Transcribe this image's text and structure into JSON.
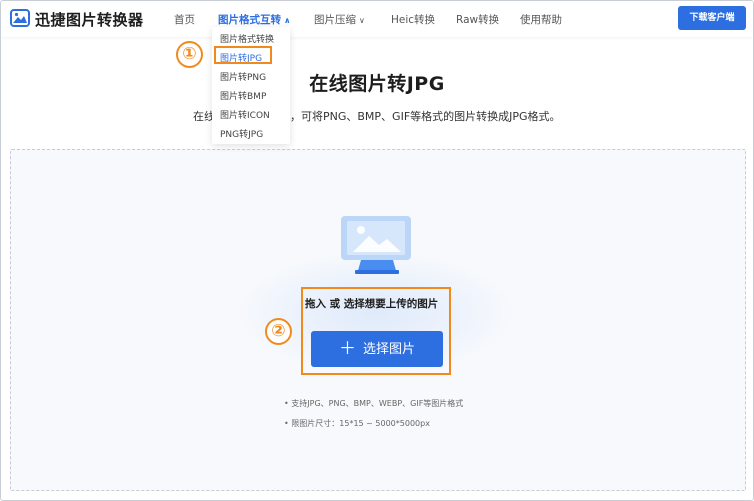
{
  "header": {
    "brand": "迅捷图片转换器",
    "nav": [
      {
        "label": "首页"
      },
      {
        "label": "图片格式互转"
      },
      {
        "label": "图片压缩"
      },
      {
        "label": "Heic转换"
      },
      {
        "label": "Raw转换"
      },
      {
        "label": "使用帮助"
      }
    ],
    "download_label": "下载客户端"
  },
  "dropdown": {
    "items": [
      "图片格式转换",
      "图片转JPG",
      "图片转PNG",
      "图片转BMP",
      "图片转ICON",
      "PNG转JPG"
    ]
  },
  "markers": {
    "one": "①",
    "two": "②"
  },
  "main": {
    "title": "在线图片转JPG",
    "subtitle_prefix": "在线",
    "subtitle": "，可将PNG、BMP、GIF等格式的图片转换成JPG格式。"
  },
  "upload": {
    "drop_text": "拖入 或 选择想要上传的图片",
    "select_label": "选择图片",
    "hints": [
      "• 支持JPG、PNG、BMP、WEBP、GIF等图片格式",
      "• 限图片尺寸：15*15 ~ 5000*5000px"
    ]
  },
  "colors": {
    "accent": "#2d6ee0",
    "highlight": "#f08a1c"
  }
}
